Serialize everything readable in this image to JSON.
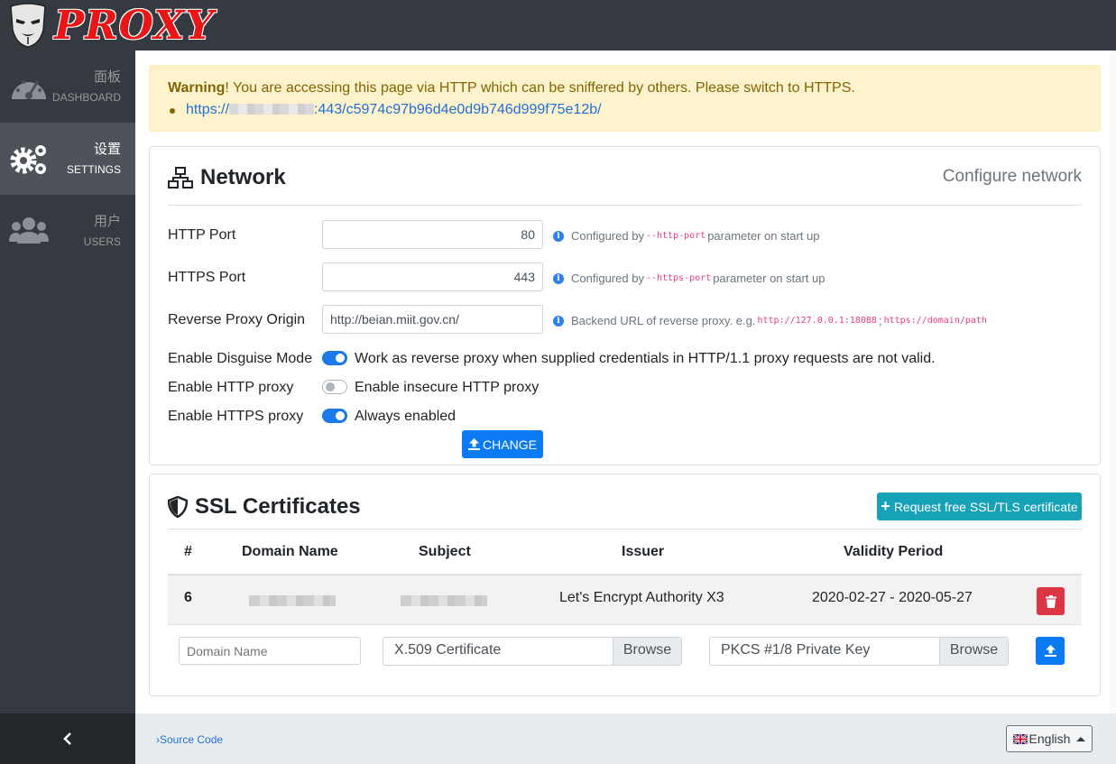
{
  "brand": {
    "logo_text": "PROXY"
  },
  "sidebar": {
    "items": [
      {
        "zh": "面板",
        "en": "DASHBOARD",
        "icon": "dashboard-gauge-icon",
        "active": false
      },
      {
        "zh": "设置",
        "en": "SETTINGS",
        "icon": "gears-icon",
        "active": true
      },
      {
        "zh": "用户",
        "en": "USERS",
        "icon": "users-icon",
        "active": false
      }
    ],
    "collapse_icon": "chevron-left-icon"
  },
  "alert": {
    "strong": "Warning",
    "message": "! You are accessing this page via HTTP which can be sniffered by others. Please switch to HTTPS.",
    "link_prefix": "https://",
    "link_suffix": ":443/c5974c97b96d4e0d9b746d999f75e12b/"
  },
  "network": {
    "title": "Network",
    "subtitle": "Configure network",
    "http_port": {
      "label": "HTTP Port",
      "value": "80",
      "help_pre": "Configured by",
      "help_code": "--http-port",
      "help_post": "parameter on start up"
    },
    "https_port": {
      "label": "HTTPS Port",
      "value": "443",
      "help_pre": "Configured by",
      "help_code": "--https-port",
      "help_post": "parameter on start up"
    },
    "origin": {
      "label": "Reverse Proxy Origin",
      "value": "http://beian.miit.gov.cn/",
      "help_pre": "Backend URL of reverse proxy. e.g.",
      "help_code1": "http://127.0.0.1:18088",
      "help_sep": ";",
      "help_code2": "https://domain/path"
    },
    "disguise": {
      "label": "Enable Disguise Mode",
      "text": "Work as reverse proxy when supplied credentials in HTTP/1.1 proxy requests are not valid.",
      "on": true
    },
    "http_proxy": {
      "label": "Enable HTTP proxy",
      "text": "Enable insecure HTTP proxy",
      "on": false
    },
    "https_proxy": {
      "label": "Enable HTTPS proxy",
      "text": "Always enabled",
      "on": true
    },
    "change_button": "CHANGE"
  },
  "ssl": {
    "title": "SSL Certificates",
    "request_button": "Request free SSL/TLS certificate",
    "columns": [
      "#",
      "Domain Name",
      "Subject",
      "Issuer",
      "Validity Period"
    ],
    "rows": [
      {
        "num": "6",
        "issuer": "Let's Encrypt Authority X3",
        "validity": "2020-02-27 - 2020-05-27"
      }
    ],
    "upload": {
      "domain_placeholder": "Domain Name",
      "cert_label": "X.509 Certificate",
      "key_label": "PKCS #1/8 Private Key",
      "browse": "Browse"
    }
  },
  "footer": {
    "source_link": "Source Code",
    "language": "English"
  },
  "colors": {
    "primary": "#0a7bf5",
    "info": "#17a2b8",
    "danger": "#dc3545",
    "dark": "#343a40",
    "warning_bg": "#fff3cd"
  }
}
